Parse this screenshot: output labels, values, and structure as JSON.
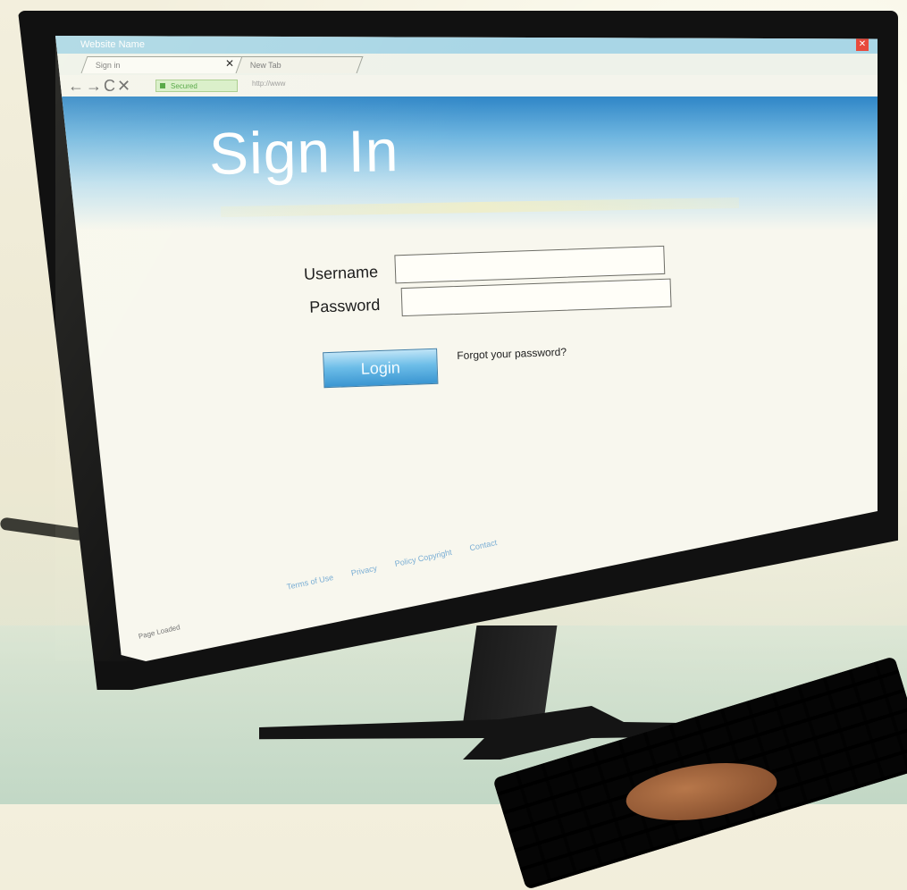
{
  "browser": {
    "window_title": "Website Name",
    "tabs": [
      {
        "label": "Sign in"
      },
      {
        "label": "New Tab"
      }
    ],
    "nav_icons": "←→C✕",
    "secure_label": "Secured",
    "url": "http://www"
  },
  "page": {
    "title": "Sign In",
    "form": {
      "username_label": "Username",
      "password_label": "Password",
      "username_value": "",
      "password_value": "",
      "login_label": "Login",
      "forgot_label": "Forgot your password?"
    },
    "footer": {
      "links": [
        "Terms of Use",
        "Privacy",
        "Policy Copyright",
        "Contact"
      ]
    },
    "status": "Page Loaded"
  }
}
